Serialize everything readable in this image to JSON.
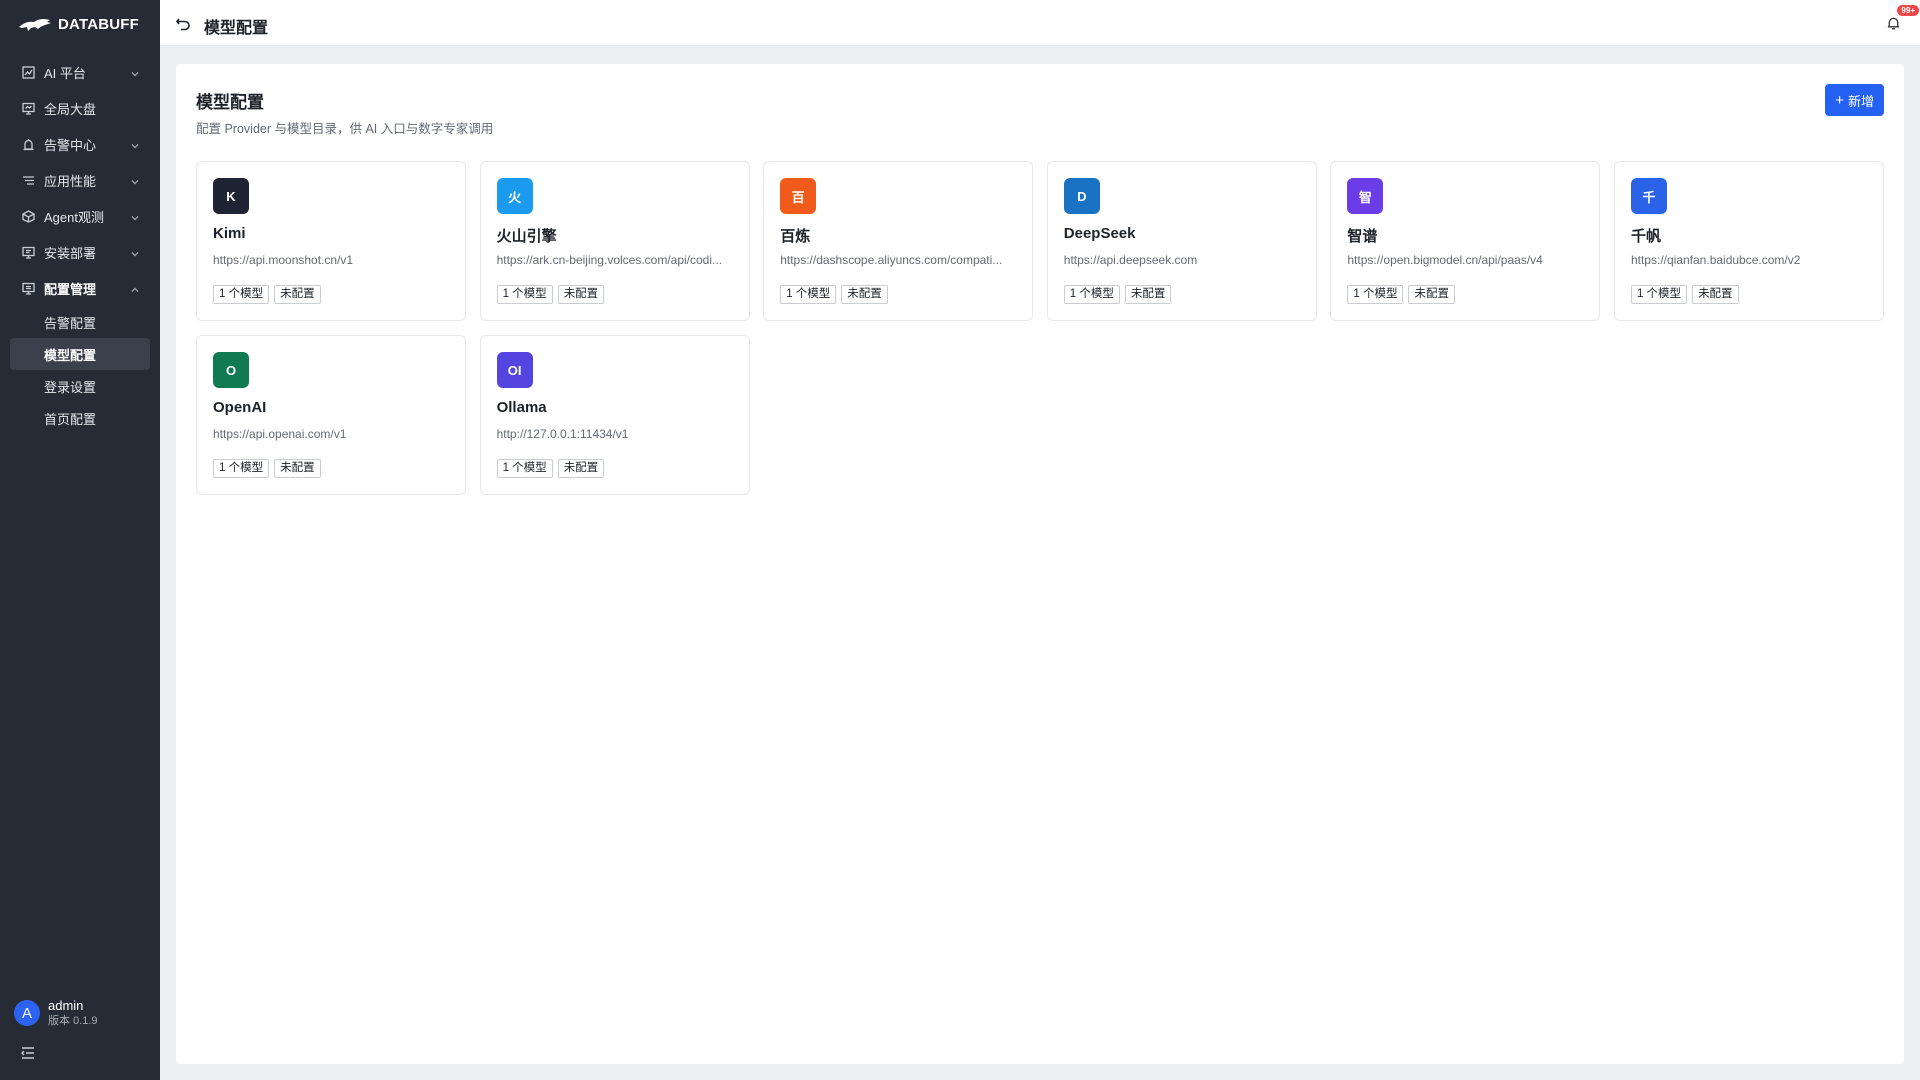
{
  "sidebar": {
    "logo_text": "DATABUFF",
    "menu": [
      {
        "label": "AI 平台",
        "icon": "chart-icon",
        "chevron": "down"
      },
      {
        "label": "全局大盘",
        "icon": "monitor-icon",
        "chevron": ""
      },
      {
        "label": "告警中心",
        "icon": "alarm-icon",
        "chevron": "down"
      },
      {
        "label": "应用性能",
        "icon": "filter-lines-icon",
        "chevron": "down"
      },
      {
        "label": "Agent观测",
        "icon": "cube-icon",
        "chevron": "down"
      },
      {
        "label": "安装部署",
        "icon": "deploy-icon",
        "chevron": "down"
      },
      {
        "label": "配置管理",
        "icon": "config-icon",
        "chevron": "up"
      }
    ],
    "submenu": [
      {
        "label": "告警配置",
        "active": false
      },
      {
        "label": "模型配置",
        "active": true
      },
      {
        "label": "登录设置",
        "active": false
      },
      {
        "label": "首页配置",
        "active": false
      }
    ],
    "user": {
      "avatar": "A",
      "name": "admin",
      "version": "版本 0.1.9"
    }
  },
  "header": {
    "title": "模型配置",
    "badge": "99+"
  },
  "panel": {
    "title": "模型配置",
    "description": "配置 Provider 与模型目录，供 AI 入口与数字专家调用",
    "add_button": "新增",
    "add_icon": "+"
  },
  "providers": [
    {
      "logo": "K",
      "color": "#1e2433",
      "name": "Kimi",
      "url": "https://api.moonshot.cn/v1",
      "models": "1 个模型",
      "status": "未配置"
    },
    {
      "logo": "火",
      "color": "#1a9bf0",
      "name": "火山引擎",
      "url": "https://ark.cn-beijing.volces.com/api/codi...",
      "models": "1 个模型",
      "status": "未配置"
    },
    {
      "logo": "百",
      "color": "#f05a1a",
      "name": "百炼",
      "url": "https://dashscope.aliyuncs.com/compati...",
      "models": "1 个模型",
      "status": "未配置"
    },
    {
      "logo": "D",
      "color": "#1a72c4",
      "name": "DeepSeek",
      "url": "https://api.deepseek.com",
      "models": "1 个模型",
      "status": "未配置"
    },
    {
      "logo": "智",
      "color": "#6a3de8",
      "name": "智谱",
      "url": "https://open.bigmodel.cn/api/paas/v4",
      "models": "1 个模型",
      "status": "未配置"
    },
    {
      "logo": "千",
      "color": "#2a63e8",
      "name": "千帆",
      "url": "https://qianfan.baidubce.com/v2",
      "models": "1 个模型",
      "status": "未配置"
    },
    {
      "logo": "O",
      "color": "#127a52",
      "name": "OpenAI",
      "url": "https://api.openai.com/v1",
      "models": "1 个模型",
      "status": "未配置"
    },
    {
      "logo": "OI",
      "color": "#5445e0",
      "name": "Ollama",
      "url": "http://127.0.0.1:11434/v1",
      "models": "1 个模型",
      "status": "未配置"
    }
  ]
}
